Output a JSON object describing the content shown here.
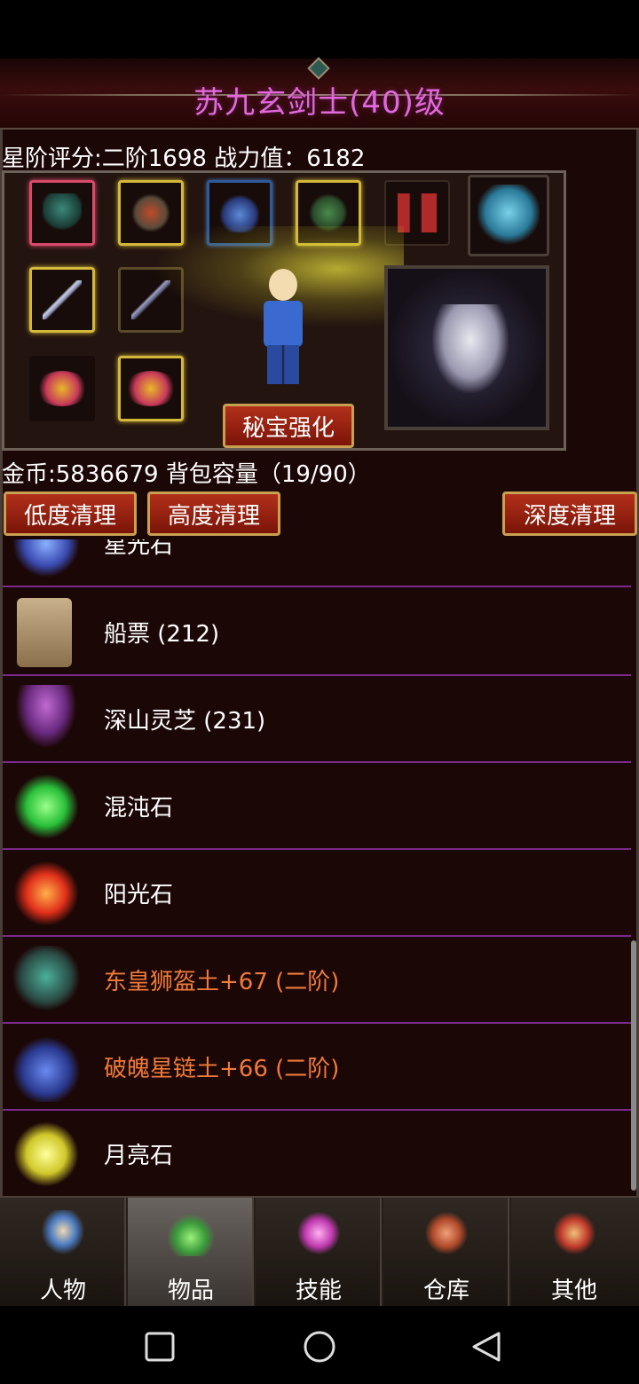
{
  "title": "苏九玄剑士(40)级",
  "stats": {
    "star_rating": "星阶评分:二阶1698 战力值：6182"
  },
  "equip": {
    "enhance_label": "秘宝强化"
  },
  "bag": {
    "gold_info": "金币:5836679 背包容量（19/90）",
    "clean_low": "低度清理",
    "clean_high": "高度清理",
    "clean_deep": "深度清理"
  },
  "items": [
    {
      "name": "星光石",
      "icon": "star-light-stone-icon",
      "color": "#5a7ae0"
    },
    {
      "name": "船票 (212)",
      "icon": "ship-ticket-scroll-icon",
      "color": "#b89a70"
    },
    {
      "name": "深山灵芝 (231)",
      "icon": "lingzhi-mushroom-icon",
      "color": "#9a4ab0"
    },
    {
      "name": "混沌石",
      "icon": "chaos-stone-icon",
      "color": "#3ad04a"
    },
    {
      "name": "阳光石",
      "icon": "sunlight-stone-icon",
      "color": "#e8481a"
    },
    {
      "name": "东皇狮盔土+67 (二阶)",
      "icon": "lion-helmet-icon",
      "color": "#3a8a7a"
    },
    {
      "name": "破魄星链土+66 (二阶)",
      "icon": "star-chain-icon",
      "color": "#4a6ad0"
    },
    {
      "name": "月亮石",
      "icon": "moon-stone-icon",
      "color": "#e8e84a"
    }
  ],
  "nav": [
    {
      "label": "人物",
      "icon": "character-icon",
      "color": "#4a7ac0"
    },
    {
      "label": "物品",
      "icon": "potion-icon",
      "color": "#6ad04a"
    },
    {
      "label": "技能",
      "icon": "skill-orb-icon",
      "color": "#d04ac0"
    },
    {
      "label": "仓库",
      "icon": "warehouse-icon",
      "color": "#d0603a"
    },
    {
      "label": "其他",
      "icon": "other-icon",
      "color": "#d04a3a"
    }
  ],
  "colors": {
    "title": "#e06ad8",
    "equip_item_text": "#ef7a3a",
    "divider": "#7a2a88",
    "button_red": "#b2301a",
    "button_border": "#c8a050"
  }
}
